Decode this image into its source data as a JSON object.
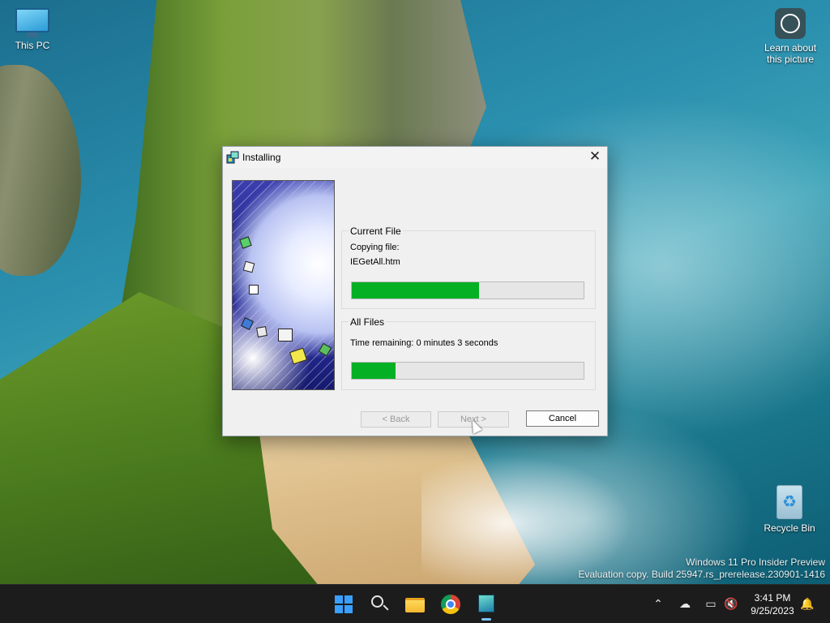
{
  "desktop": {
    "icons": [
      {
        "label": "This PC"
      },
      {
        "label": "Learn about\nthis picture"
      },
      {
        "label": "Recycle Bin"
      }
    ],
    "watermark": {
      "line1": "Windows 11 Pro Insider Preview",
      "line2": "Evaluation copy. Build 25947.rs_prerelease.230901-1416"
    }
  },
  "dialog": {
    "title": "Installing",
    "close_glyph": "✕",
    "current_file": {
      "label": "Current File",
      "status": "Copying file:",
      "filename": "IEGetAll.htm",
      "progress_percent": 55
    },
    "all_files": {
      "label": "All Files",
      "time_remaining": "Time remaining: 0 minutes 3 seconds",
      "progress_percent": 19
    },
    "buttons": {
      "back": "< Back",
      "next": "Next >",
      "cancel": "Cancel"
    }
  },
  "taskbar": {
    "items": [
      {
        "name": "start",
        "icon": "windows-logo-icon"
      },
      {
        "name": "search",
        "icon": "search-icon"
      },
      {
        "name": "file-explorer",
        "icon": "folder-icon"
      },
      {
        "name": "chrome",
        "icon": "chrome-icon"
      },
      {
        "name": "setup",
        "icon": "installer-icon"
      }
    ],
    "tray": {
      "chevron": "⌃",
      "onedrive": "☁",
      "network": "▭",
      "volume": "🔇",
      "bell": "🔔",
      "time": "3:41 PM",
      "date": "9/25/2023"
    }
  },
  "colors": {
    "progress_fill": "#06b025",
    "accent": "#3aa0ff"
  }
}
